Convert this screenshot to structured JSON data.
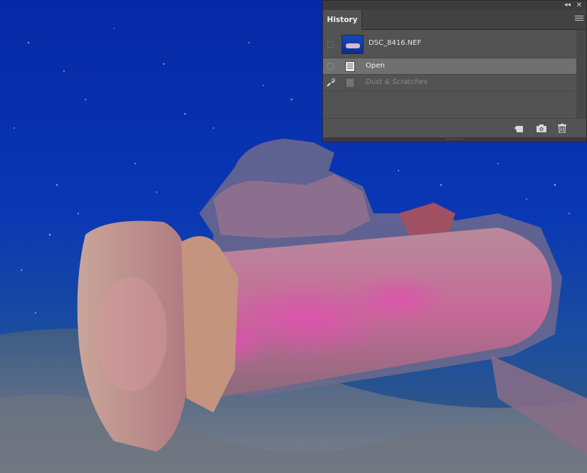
{
  "canvas": {
    "description_colors": {
      "water_top": "#062ca8",
      "water_bottom": "#1a4fb0",
      "seabed": "#5f7088",
      "coral": "#c98a9c"
    }
  },
  "panel": {
    "tab_label": "History",
    "snapshot": {
      "name": "DSC_8416.NEF"
    },
    "states": [
      {
        "label": "Open",
        "selected": true
      },
      {
        "label": "Dust & Scratches",
        "greyed": true
      }
    ],
    "icons": {
      "collapse": "double-chevron-icon",
      "close": "close-icon",
      "menu": "hamburger-icon",
      "new_document": "new-document-from-state-icon",
      "snapshot": "camera-icon",
      "delete": "trash-icon"
    }
  }
}
